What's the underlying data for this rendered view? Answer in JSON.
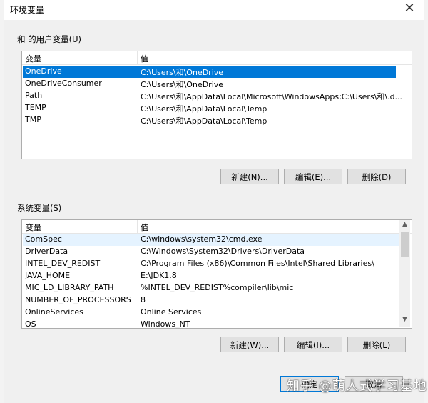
{
  "dialog": {
    "title": "环境变量",
    "close_glyph": "✕"
  },
  "user_vars": {
    "group_label": "和 的用户变量(U)",
    "col_name": "变量",
    "col_value": "值",
    "rows": [
      {
        "name": "OneDrive",
        "value": "C:\\Users\\和\\OneDrive"
      },
      {
        "name": "OneDriveConsumer",
        "value": "C:\\Users\\和\\OneDrive"
      },
      {
        "name": "Path",
        "value": "C:\\Users\\和\\AppData\\Local\\Microsoft\\WindowsApps;C:\\Users\\和\\.d..."
      },
      {
        "name": "TEMP",
        "value": "C:\\Users\\和\\AppData\\Local\\Temp"
      },
      {
        "name": "TMP",
        "value": "C:\\Users\\和\\AppData\\Local\\Temp"
      }
    ],
    "new_label": "新建(N)...",
    "edit_label": "编辑(E)...",
    "delete_label": "删除(D)"
  },
  "system_vars": {
    "group_label": "系统变量(S)",
    "col_name": "变量",
    "col_value": "值",
    "rows": [
      {
        "name": "ComSpec",
        "value": "C:\\windows\\system32\\cmd.exe"
      },
      {
        "name": "DriverData",
        "value": "C:\\Windows\\System32\\Drivers\\DriverData"
      },
      {
        "name": "INTEL_DEV_REDIST",
        "value": "C:\\Program Files (x86)\\Common Files\\Intel\\Shared Libraries\\"
      },
      {
        "name": "JAVA_HOME",
        "value": "E:\\JDK1.8"
      },
      {
        "name": "MIC_LD_LIBRARY_PATH",
        "value": "%INTEL_DEV_REDIST%compiler\\lib\\mic"
      },
      {
        "name": "NUMBER_OF_PROCESSORS",
        "value": "8"
      },
      {
        "name": "OnlineServices",
        "value": "Online Services"
      },
      {
        "name": "OS",
        "value": "Windows_NT"
      }
    ],
    "new_label": "新建(W)...",
    "edit_label": "编辑(I)...",
    "delete_label": "删除(L)"
  },
  "footer": {
    "ok_label": "确定",
    "cancel_label": "取消"
  },
  "watermark": "知乎 @萌人式学习基地"
}
